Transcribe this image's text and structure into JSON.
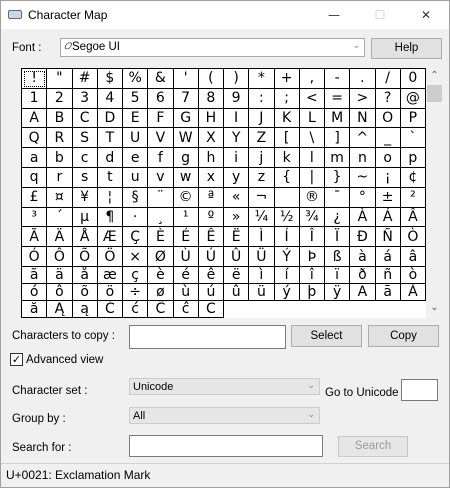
{
  "window": {
    "title": "Character Map",
    "minimize": "—",
    "maximize": "☐",
    "close": "✕"
  },
  "font": {
    "label": "Font :",
    "glyph": "𝑂",
    "value": "Segoe UI",
    "help": "Help"
  },
  "grid": {
    "selected_index": 0,
    "chars": [
      "!",
      "\"",
      "#",
      "$",
      "%",
      "&",
      "'",
      "(",
      ")",
      "*",
      "+",
      ",",
      "-",
      ".",
      "/",
      "0",
      "1",
      "2",
      "3",
      "4",
      "5",
      "6",
      "7",
      "8",
      "9",
      ":",
      ";",
      "<",
      "=",
      ">",
      "?",
      "@",
      "A",
      "B",
      "C",
      "D",
      "E",
      "F",
      "G",
      "H",
      "I",
      "J",
      "K",
      "L",
      "M",
      "N",
      "O",
      "P",
      "Q",
      "R",
      "S",
      "T",
      "U",
      "V",
      "W",
      "X",
      "Y",
      "Z",
      "[",
      "\\",
      "]",
      "^",
      "_",
      "`",
      "a",
      "b",
      "c",
      "d",
      "e",
      "f",
      "g",
      "h",
      "i",
      "j",
      "k",
      "l",
      "m",
      "n",
      "o",
      "p",
      "q",
      "r",
      "s",
      "t",
      "u",
      "v",
      "w",
      "x",
      "y",
      "z",
      "{",
      "|",
      "}",
      "~",
      "¡",
      "¢",
      "£",
      "¤",
      "¥",
      "¦",
      "§",
      "¨",
      "©",
      "ª",
      "«",
      "¬",
      "­",
      "®",
      "¯",
      "°",
      "±",
      "²",
      "³",
      "´",
      "µ",
      "¶",
      "·",
      "¸",
      "¹",
      "º",
      "»",
      "¼",
      "½",
      "¾",
      "¿",
      "À",
      "Á",
      "Â",
      "Ã",
      "Ä",
      "Å",
      "Æ",
      "Ç",
      "È",
      "É",
      "Ê",
      "Ë",
      "Ì",
      "Í",
      "Î",
      "Ï",
      "Ð",
      "Ñ",
      "Ò",
      "Ó",
      "Ô",
      "Õ",
      "Ö",
      "×",
      "Ø",
      "Ù",
      "Ú",
      "Û",
      "Ü",
      "Ý",
      "Þ",
      "ß",
      "à",
      "á",
      "â",
      "ã",
      "ä",
      "å",
      "æ",
      "ç",
      "è",
      "é",
      "ê",
      "ë",
      "ì",
      "í",
      "î",
      "ï",
      "ð",
      "ñ",
      "ò",
      "ó",
      "ô",
      "õ",
      "ö",
      "÷",
      "ø",
      "ù",
      "ú",
      "û",
      "ü",
      "ý",
      "þ",
      "ÿ",
      "Ā",
      "ā",
      "Ă",
      "ă",
      "Ą",
      "ą",
      "Ć",
      "ć",
      "Ĉ",
      "ĉ",
      "Ċ"
    ]
  },
  "scrollbar": {
    "up_glyph": "⌃",
    "down_glyph": "⌄"
  },
  "copy_row": {
    "label": "Characters to copy :",
    "value": "",
    "select": "Select",
    "copy": "Copy"
  },
  "advanced": {
    "label": "Advanced view",
    "checked_glyph": "✓"
  },
  "charset": {
    "label": "Character set :",
    "value": "Unicode",
    "arrow": "⌄"
  },
  "goto": {
    "label": "Go to Unicode :",
    "value": ""
  },
  "groupby": {
    "label": "Group by :",
    "value": "All",
    "arrow": "⌄"
  },
  "search": {
    "label": "Search for :",
    "value": "",
    "button": "Search"
  },
  "status": {
    "text": "U+0021: Exclamation Mark"
  }
}
